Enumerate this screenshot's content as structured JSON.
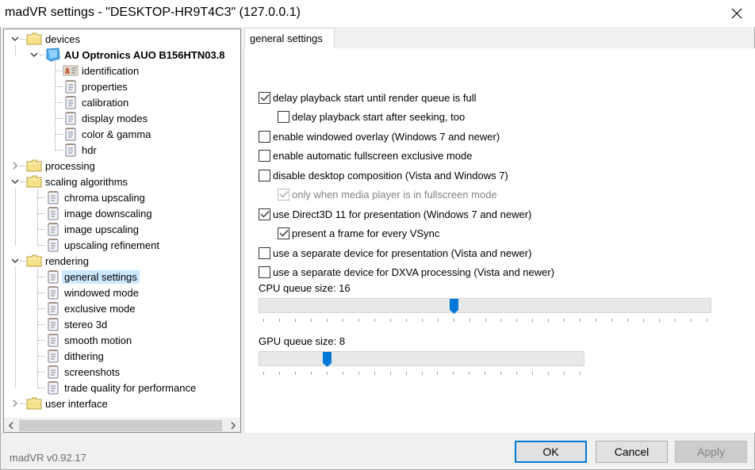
{
  "window": {
    "title": "madVR settings - \"DESKTOP-HR9T4C3\" (127.0.0.1)",
    "close_icon": "close-icon"
  },
  "tree": {
    "items": [
      {
        "label": "devices",
        "level": 0,
        "icon": "folder-icon",
        "expanded": true
      },
      {
        "label": "AU Optronics AUO B156HTN03.8",
        "level": 1,
        "icon": "monitor-icon",
        "expanded": true,
        "bold": true
      },
      {
        "label": "identification",
        "level": 2,
        "icon": "id-card-icon"
      },
      {
        "label": "properties",
        "level": 2,
        "icon": "document-icon"
      },
      {
        "label": "calibration",
        "level": 2,
        "icon": "document-icon"
      },
      {
        "label": "display modes",
        "level": 2,
        "icon": "document-icon"
      },
      {
        "label": "color & gamma",
        "level": 2,
        "icon": "document-icon"
      },
      {
        "label": "hdr",
        "level": 2,
        "icon": "document-icon"
      },
      {
        "label": "processing",
        "level": 0,
        "icon": "folder-icon",
        "expanded": false
      },
      {
        "label": "scaling algorithms",
        "level": 0,
        "icon": "folder-icon",
        "expanded": true
      },
      {
        "label": "chroma upscaling",
        "level": 1,
        "icon": "document-icon"
      },
      {
        "label": "image downscaling",
        "level": 1,
        "icon": "document-icon"
      },
      {
        "label": "image upscaling",
        "level": 1,
        "icon": "document-icon"
      },
      {
        "label": "upscaling refinement",
        "level": 1,
        "icon": "document-icon"
      },
      {
        "label": "rendering",
        "level": 0,
        "icon": "folder-icon",
        "expanded": true
      },
      {
        "label": "general settings",
        "level": 1,
        "icon": "document-icon",
        "selected": true
      },
      {
        "label": "windowed mode",
        "level": 1,
        "icon": "document-icon"
      },
      {
        "label": "exclusive mode",
        "level": 1,
        "icon": "document-icon"
      },
      {
        "label": "stereo 3d",
        "level": 1,
        "icon": "document-icon"
      },
      {
        "label": "smooth motion",
        "level": 1,
        "icon": "document-icon"
      },
      {
        "label": "dithering",
        "level": 1,
        "icon": "document-icon"
      },
      {
        "label": "screenshots",
        "level": 1,
        "icon": "document-icon"
      },
      {
        "label": "trade quality for performance",
        "level": 1,
        "icon": "document-icon"
      },
      {
        "label": "user interface",
        "level": 0,
        "icon": "folder-icon",
        "expanded": false
      }
    ]
  },
  "tab": {
    "label": "general settings"
  },
  "options": [
    {
      "label": "delay playback start until render queue is full",
      "checked": true,
      "indent": 0,
      "disabled": false
    },
    {
      "label": "delay playback start after seeking, too",
      "checked": false,
      "indent": 1,
      "disabled": false
    },
    {
      "label": "enable windowed overlay (Windows 7 and newer)",
      "checked": false,
      "indent": 0,
      "disabled": false
    },
    {
      "label": "enable automatic fullscreen exclusive mode",
      "checked": false,
      "indent": 0,
      "disabled": false
    },
    {
      "label": "disable desktop composition (Vista and Windows 7)",
      "checked": false,
      "indent": 0,
      "disabled": false
    },
    {
      "label": "only when media player is in fullscreen mode",
      "checked": true,
      "indent": 1,
      "disabled": true
    },
    {
      "label": "use Direct3D 11 for presentation (Windows 7 and newer)",
      "checked": true,
      "indent": 0,
      "disabled": false
    },
    {
      "label": "present a frame for every VSync",
      "checked": true,
      "indent": 1,
      "disabled": false
    },
    {
      "label": "use a separate device for presentation (Vista and newer)",
      "checked": false,
      "indent": 0,
      "disabled": false
    },
    {
      "label": "use a separate device for DXVA processing (Vista and newer)",
      "checked": false,
      "indent": 0,
      "disabled": false
    }
  ],
  "sliders": {
    "cpu": {
      "label": "CPU queue size: 16",
      "value": 16,
      "min": 4,
      "max": 32
    },
    "gpu": {
      "label": "GPU queue size: 8",
      "value": 8,
      "min": 4,
      "max": 24
    }
  },
  "footer": {
    "version": "madVR v0.92.17",
    "ok": "OK",
    "cancel": "Cancel",
    "apply": "Apply"
  },
  "colors": {
    "accent": "#0078d7",
    "selection": "#cce8ff",
    "folder": "#f7e28c"
  }
}
